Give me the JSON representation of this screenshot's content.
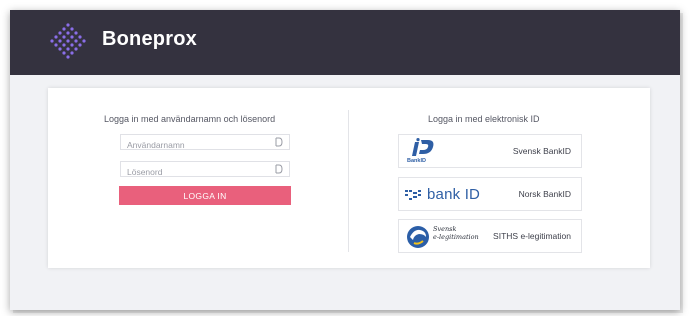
{
  "header": {
    "brand": "Boneprox",
    "logo_icon": "diamond-dots-icon"
  },
  "login_form": {
    "heading": "Logga in med användarnamn och lösenord",
    "username_placeholder": "Användarnamn",
    "password_placeholder": "Lösenord",
    "submit_label": "LOGGA IN"
  },
  "eid": {
    "heading": "Logga in med elektronisk ID",
    "options": [
      {
        "label": "Svensk BankID",
        "logo": "bankid-logo",
        "logo_text": "BankID"
      },
      {
        "label": "Norsk BankID",
        "logo": "norsk-bankid-logo",
        "logo_text": "bank ID"
      },
      {
        "label": "SITHS e-legitimation",
        "logo": "svensk-e-legitimation-logo",
        "logo_text": [
          "Svensk",
          "e-legitimation"
        ]
      }
    ]
  },
  "colors": {
    "topbar": "#34323f",
    "accent": "#e9607c",
    "logo_purple": "#8a6ee8",
    "bankid_blue": "#2f5fa5"
  }
}
